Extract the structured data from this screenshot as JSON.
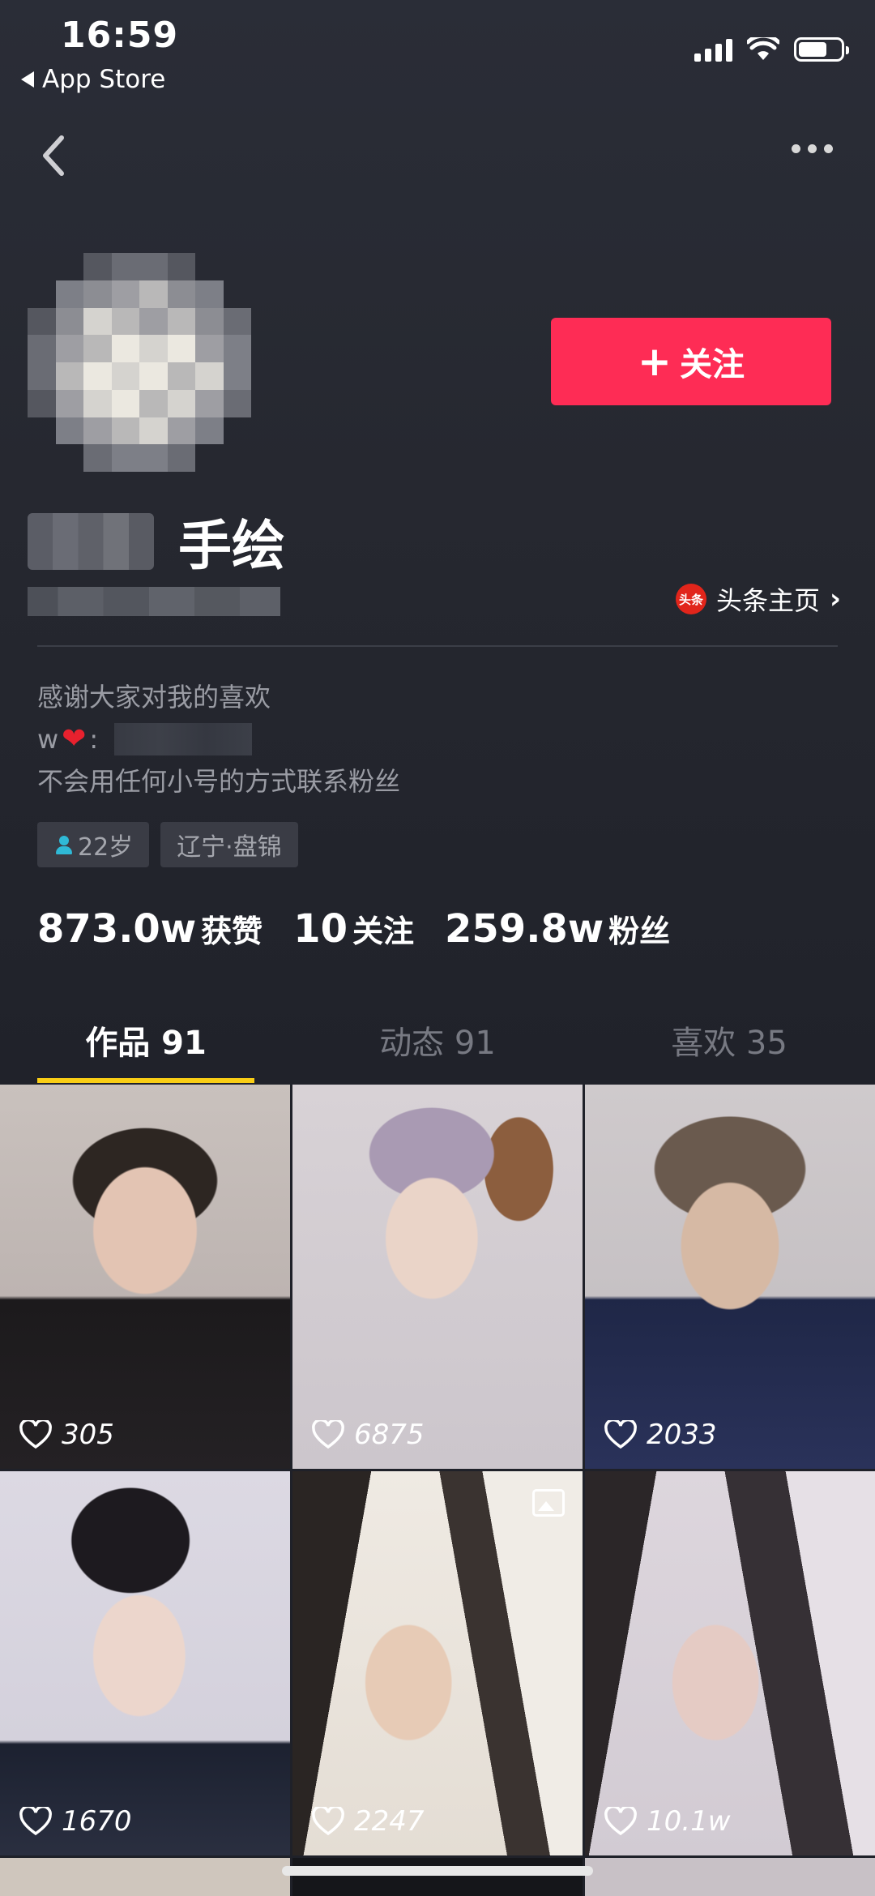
{
  "status_bar": {
    "time": "16:59",
    "back_app": "App Store"
  },
  "profile": {
    "name_suffix": "手绘",
    "follow_label": "关注",
    "toutiao_logo_text": "头条",
    "toutiao_label": "头条主页",
    "bio_line1": "感谢大家对我的喜欢",
    "bio_line2_prefix": "w",
    "bio_line2_sep": ":",
    "bio_line3": "不会用任何小号的方式联系粉丝",
    "tags": [
      {
        "label": "22岁"
      },
      {
        "label": "辽宁·盘锦"
      }
    ],
    "stats": [
      {
        "value": "873.0w",
        "label": "获赞"
      },
      {
        "value": "10",
        "label": "关注"
      },
      {
        "value": "259.8w",
        "label": "粉丝"
      }
    ]
  },
  "tabs": [
    {
      "label": "作品 91",
      "active": true
    },
    {
      "label": "动态 91",
      "active": false
    },
    {
      "label": "喜欢 35",
      "active": false
    }
  ],
  "videos": [
    {
      "likes": "305",
      "bg": "#6b5f5a"
    },
    {
      "likes": "6875",
      "bg": "#c9c2c6"
    },
    {
      "likes": "2033",
      "bg": "#6f6f7d"
    },
    {
      "likes": "1670",
      "bg": "#8a8693"
    },
    {
      "likes": "2247",
      "bg": "#b7aea4",
      "image_post": true
    },
    {
      "likes": "10.1w",
      "bg": "#a69aa7"
    }
  ],
  "colors": {
    "accent_follow": "#fe2c55",
    "tab_indicator": "#face15",
    "background": "#1f2129"
  }
}
